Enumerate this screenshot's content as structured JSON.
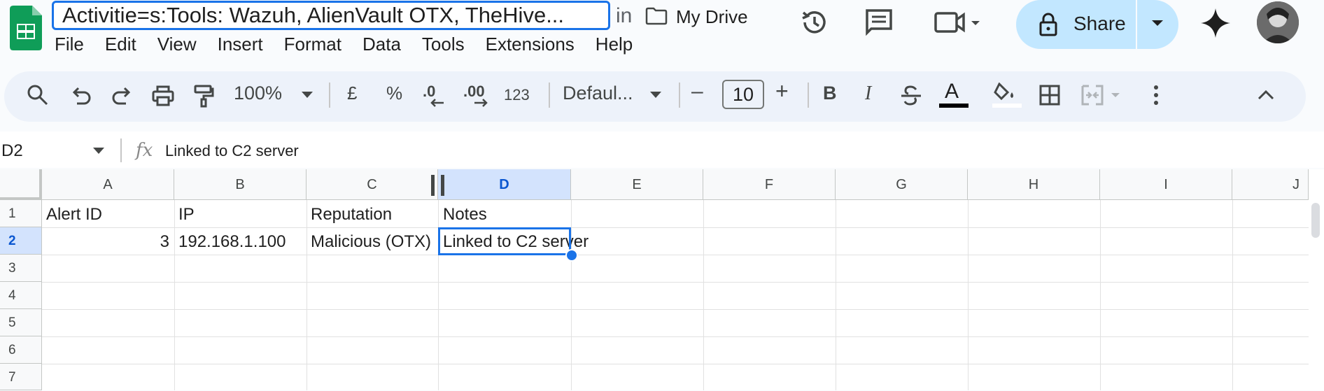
{
  "doc": {
    "title": "Activitie=s:Tools: Wazuh, AlienVault OTX, TheHive...",
    "in_label": "in",
    "location": "My Drive"
  },
  "menu": [
    "File",
    "Edit",
    "View",
    "Insert",
    "Format",
    "Data",
    "Tools",
    "Extensions",
    "Help"
  ],
  "share": {
    "label": "Share"
  },
  "toolbar": {
    "zoom": "100%",
    "currency": "£",
    "percent": "%",
    "dec_decrease": ".0",
    "dec_increase": ".00",
    "number_format": "123",
    "font": "Defaul...",
    "minus": "–",
    "font_size": "10",
    "plus": "+",
    "bold": "B",
    "italic": "I",
    "text_color_label": "A"
  },
  "formula_bar": {
    "cell_ref": "D2",
    "fx": "fx",
    "value": "Linked to C2 server"
  },
  "sheet": {
    "columns": [
      "A",
      "B",
      "C",
      "D",
      "E",
      "F",
      "G",
      "H",
      "I",
      "J"
    ],
    "rows": [
      "1",
      "2",
      "3",
      "4",
      "5",
      "6",
      "7"
    ],
    "selected_col": "D",
    "selected_row": "2",
    "cells": {
      "A1": "Alert ID",
      "B1": "IP",
      "C1": "Reputation",
      "D1": "Notes",
      "A2": "3",
      "B2": "192.168.1.100",
      "C2": "Malicious (OTX)",
      "D2": "Linked to C2 server"
    }
  },
  "colors": {
    "accent": "#1a73e8",
    "share_bg": "#c2e7ff",
    "selected_header": "#d3e3fd"
  }
}
